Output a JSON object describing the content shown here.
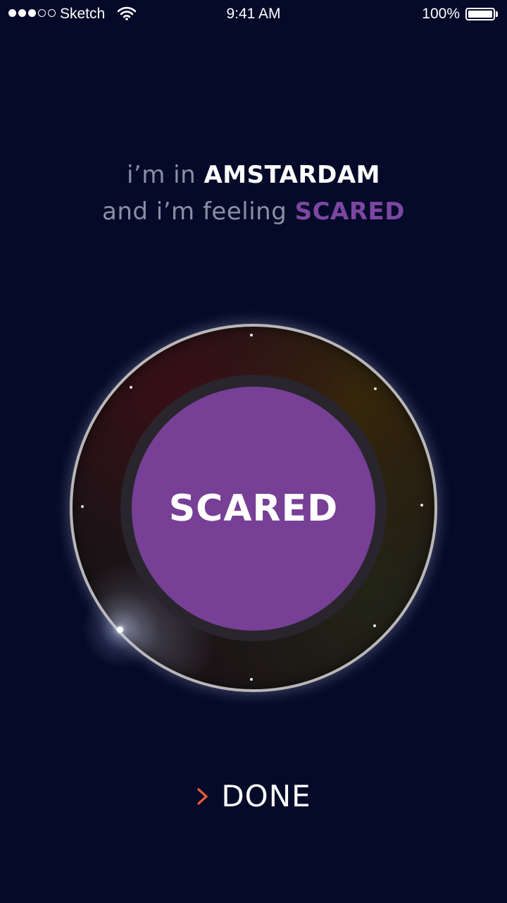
{
  "status_bar": {
    "carrier": "Sketch",
    "time": "9:41 AM",
    "battery_percent": "100%",
    "signal_filled": 3,
    "signal_total": 5,
    "battery_level": 1.0
  },
  "headline": {
    "line1_prefix": "i’m in",
    "city": "AMSTARDAM",
    "line2_prefix": "and i’m feeling",
    "mood": "SCARED"
  },
  "dial": {
    "selected_mood": "SCARED"
  },
  "done": {
    "icon": "chevron-right-icon",
    "label": "DONE"
  },
  "colors": {
    "background": "#040a28",
    "mood_accent": "#773f95",
    "done_chevron": "#e8573a",
    "muted_text": "#8b8fa5"
  }
}
